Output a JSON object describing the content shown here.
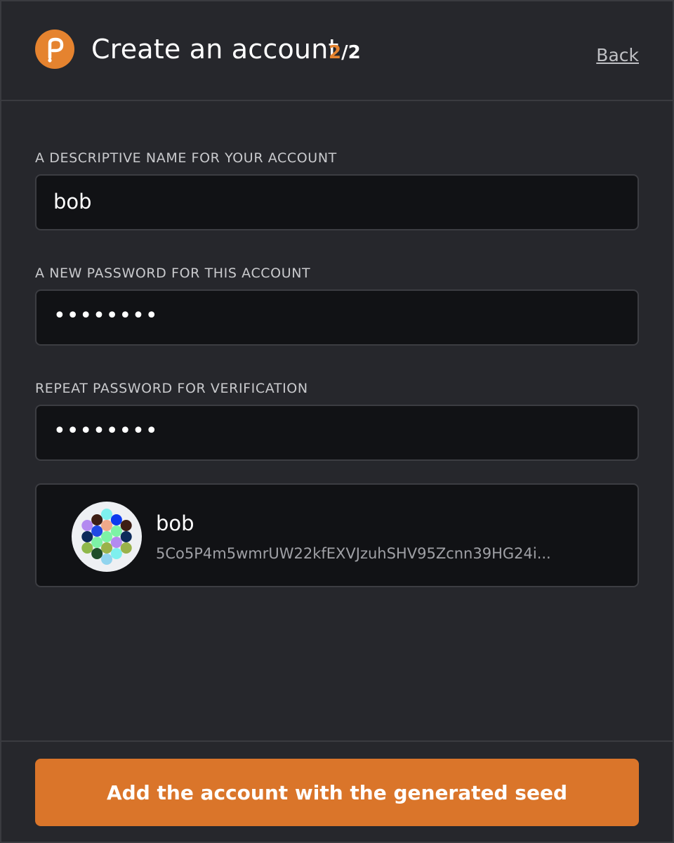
{
  "header": {
    "title": "Create an account",
    "step_current": "2",
    "step_total": "/2",
    "back_label": "Back"
  },
  "form": {
    "name_label": "A DESCRIPTIVE NAME FOR YOUR ACCOUNT",
    "name_value": "bob",
    "password_label": "A NEW PASSWORD FOR THIS ACCOUNT",
    "password_masked": "••••••••",
    "repeat_label": "REPEAT PASSWORD FOR VERIFICATION",
    "repeat_masked": "••••••••"
  },
  "account": {
    "name": "bob",
    "address": "5Co5P4m5wmrUW22kfEXVJzuhSHV95Zcnn39HG24i...",
    "identicon_colors": [
      "#b38af0",
      "#0c2a5a",
      "#8fb84a",
      "#3d1e14",
      "#2049e3",
      "#7df3a6",
      "#1f4d2a",
      "#7ef0ee",
      "#f0a98a",
      "#7df3a6",
      "#9ab24a",
      "#90d4ee",
      "#0c3aee",
      "#7df3a6",
      "#b38af0",
      "#7ef0ee",
      "#3d1e14",
      "#0c2a5a",
      "#9ab24a"
    ]
  },
  "footer": {
    "cta_label": "Add the account with the generated seed"
  },
  "colors": {
    "accent": "#e5832f",
    "button": "#da752a",
    "background": "#26272c",
    "input_bg": "#111215"
  }
}
